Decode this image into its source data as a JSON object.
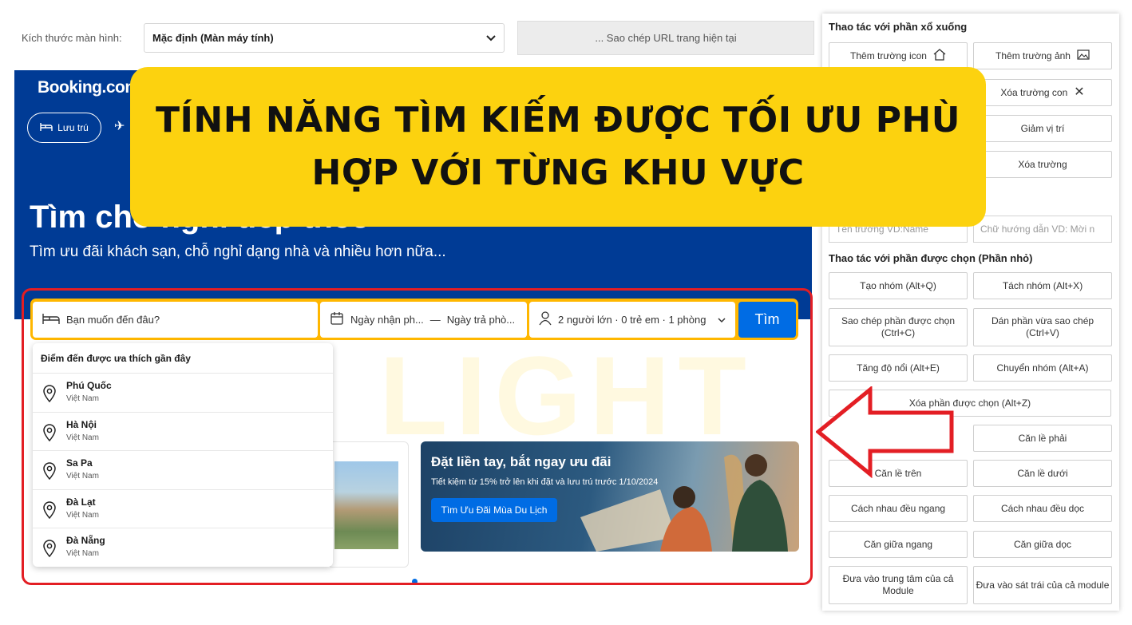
{
  "toolbar": {
    "screen_size_label": "Kích thước màn hình:",
    "screen_size_value": "Mặc định (Màn máy tính)",
    "copy_url": "... Sao chép URL trang hiện tại"
  },
  "booking": {
    "logo": "Booking.com",
    "nav_stays": "Lưu trú",
    "hero_title": "Tìm chỗ nghỉ tiếp theo",
    "hero_subtitle": "Tìm ưu đãi khách sạn, chỗ nghỉ dạng nhà và nhiều hơn nữa...",
    "search": {
      "destination_placeholder": "Bạn muốn đến đâu?",
      "checkin": "Ngày nhận ph...",
      "separator": "—",
      "checkout": "Ngày trả phò...",
      "guests": "2 người lớn · 0 trẻ em · 1 phòng",
      "button": "Tìm"
    },
    "dropdown": {
      "title": "Điểm đến được ưa thích gần đây",
      "items": [
        {
          "name": "Phú Quốc",
          "country": "Việt Nam"
        },
        {
          "name": "Hà Nội",
          "country": "Việt Nam"
        },
        {
          "name": "Sa Pa",
          "country": "Việt Nam"
        },
        {
          "name": "Đà Lạt",
          "country": "Việt Nam"
        },
        {
          "name": "Đà Nẵng",
          "country": "Việt Nam"
        }
      ]
    },
    "promo": {
      "title": "Đặt liền tay, bắt ngay ưu đãi",
      "subtitle": "Tiết kiệm từ 15% trở lên khi đặt và lưu trú trước 1/10/2024",
      "button": "Tìm Ưu Đãi Mùa Du Lịch"
    }
  },
  "banner": {
    "line1": "TÍNH NĂNG TÌM KIẾM ĐƯỢC TỐI ƯU PHÙ",
    "line2": "HỢP VỚI TỪNG KHU VỰC"
  },
  "watermark": "LIGHT",
  "panel": {
    "dropdown_heading": "Thao tác với phần xổ xuống",
    "add_icon_field": "Thêm trường icon",
    "add_image_field": "Thêm trường ảnh",
    "remove_child_field": "Xóa trường con",
    "decrease_position": "Giảm vị trí",
    "remove_field": "Xóa trường",
    "field_name_placeholder": "Tên trường VD:Name",
    "hint_placeholder": "Chữ hướng dẫn VD: Mời n",
    "selection_heading": "Thao tác với phần được chọn (Phần nhỏ)",
    "buttons": {
      "group": "Tạo nhóm (Alt+Q)",
      "ungroup": "Tách nhóm (Alt+X)",
      "copy_selected": "Sao chép phần được chọn (Ctrl+C)",
      "paste": "Dán phần vừa sao chép (Ctrl+V)",
      "raise": "Tăng độ nổi (Alt+E)",
      "move_group": "Chuyển nhóm (Alt+A)",
      "delete_selected": "Xóa phần được chọn (Alt+Z)",
      "align_right": "Căn lề phải",
      "align_top": "Căn lề trên",
      "align_bottom": "Căn lề dưới",
      "space_h": "Cách nhau đều ngang",
      "space_v": "Cách nhau đều dọc",
      "center_h": "Căn giữa ngang",
      "center_v": "Căn giữa dọc",
      "center_module": "Đưa vào trung tâm của cả Module",
      "left_module": "Đưa vào sát trái của cả module"
    }
  },
  "colors": {
    "booking_blue": "#003b95",
    "search_yellow": "#ffb700",
    "button_blue": "#006ce4",
    "banner_yellow": "#fcd20f",
    "highlight_red": "#e31e24"
  }
}
